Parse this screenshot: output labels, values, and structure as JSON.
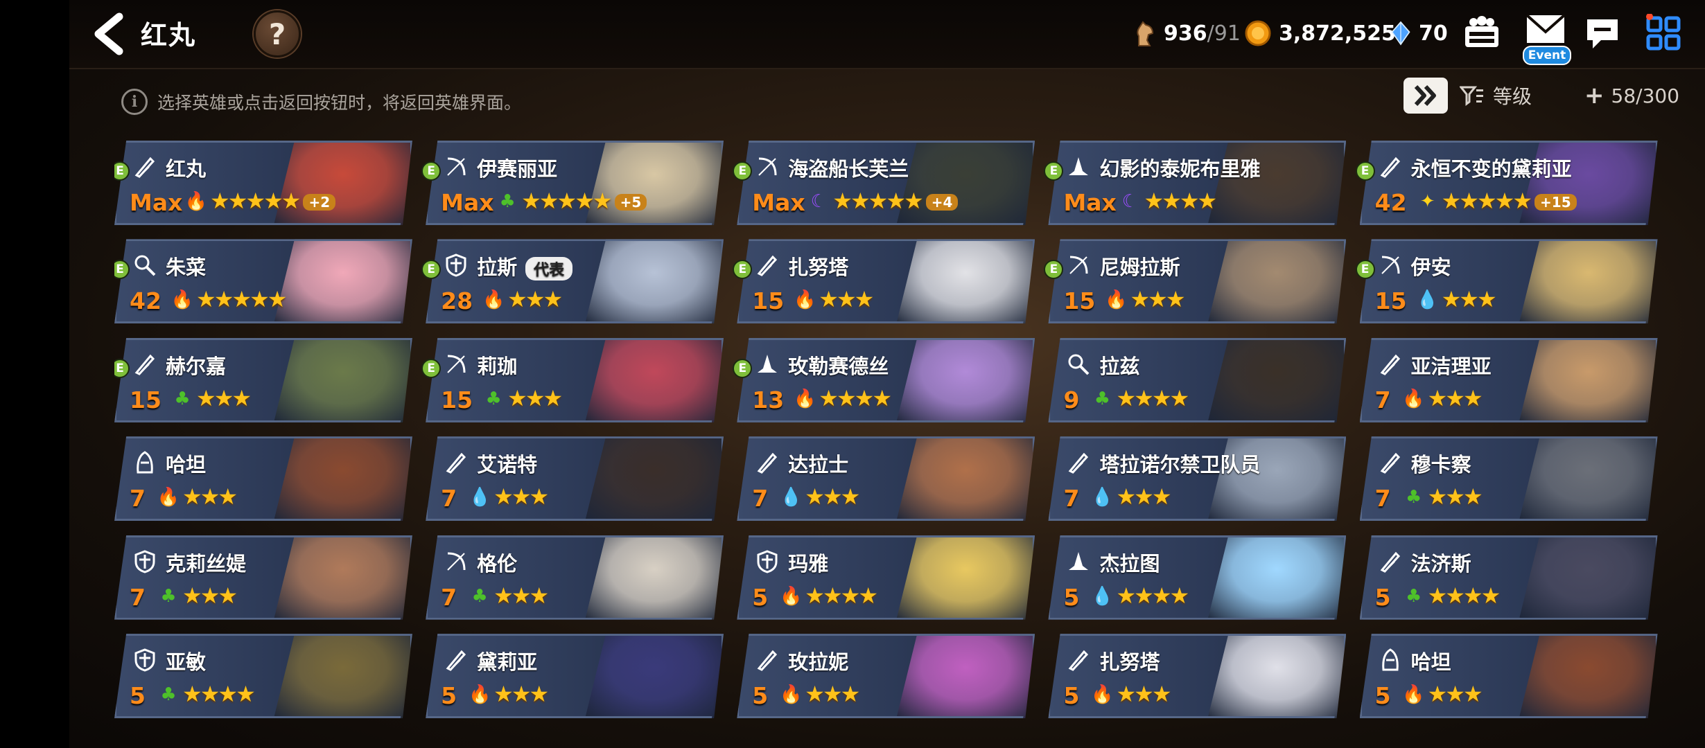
{
  "header": {
    "title": "红丸",
    "help_label": "?",
    "stamina_current": "936",
    "stamina_max": "/91",
    "gold": "3,872,525",
    "crystal": "70",
    "event_label": "Event"
  },
  "notice": {
    "icon_label": "i",
    "text": "选择英雄或点击返回按钮时，将返回英雄界面。"
  },
  "toolbar": {
    "sort_label": "等级",
    "count": "58/300"
  },
  "colors": {
    "level": "#ff8c1a",
    "star": "#ffc21a",
    "badge_e": "#7fbf3a"
  },
  "heroes": [
    {
      "name": "红丸",
      "e": true,
      "cls": "sword",
      "level": "Max",
      "elem": "fire",
      "stars": "★★★★★",
      "plus": "+2",
      "rep": ""
    },
    {
      "name": "伊赛丽亚",
      "e": true,
      "cls": "bow",
      "level": "Max",
      "elem": "tree",
      "stars": "★★★★★",
      "plus": "+5",
      "rep": ""
    },
    {
      "name": "海盗船长芙兰",
      "e": true,
      "cls": "bow",
      "level": "Max",
      "elem": "dark",
      "stars": "★★★★★",
      "plus": "+4",
      "rep": ""
    },
    {
      "name": "幻影的泰妮布里雅",
      "e": true,
      "cls": "mage",
      "level": "Max",
      "elem": "dark",
      "stars": "★★★★",
      "plus": "",
      "rep": ""
    },
    {
      "name": "永恒不变的黛莉亚",
      "e": true,
      "cls": "sword",
      "level": "42",
      "elem": "light",
      "stars": "★★★★★",
      "plus": "+15",
      "rep": ""
    },
    {
      "name": "朱菜",
      "e": true,
      "cls": "support",
      "level": "42",
      "elem": "fire",
      "stars": "★★★★★",
      "plus": "",
      "rep": ""
    },
    {
      "name": "拉斯",
      "e": true,
      "cls": "shield",
      "level": "28",
      "elem": "fire",
      "stars": "★★★",
      "plus": "",
      "rep": "代表"
    },
    {
      "name": "扎努塔",
      "e": true,
      "cls": "sword",
      "level": "15",
      "elem": "fire",
      "stars": "★★★",
      "plus": "",
      "rep": ""
    },
    {
      "name": "尼姆拉斯",
      "e": true,
      "cls": "bow",
      "level": "15",
      "elem": "fire",
      "stars": "★★★",
      "plus": "",
      "rep": ""
    },
    {
      "name": "伊安",
      "e": true,
      "cls": "bow",
      "level": "15",
      "elem": "water",
      "stars": "★★★",
      "plus": "",
      "rep": ""
    },
    {
      "name": "赫尔嘉",
      "e": true,
      "cls": "sword",
      "level": "15",
      "elem": "tree",
      "stars": "★★★",
      "plus": "",
      "rep": ""
    },
    {
      "name": "莉珈",
      "e": true,
      "cls": "bow",
      "level": "15",
      "elem": "tree",
      "stars": "★★★",
      "plus": "",
      "rep": ""
    },
    {
      "name": "玫勒赛德丝",
      "e": true,
      "cls": "mage",
      "level": "13",
      "elem": "fire",
      "stars": "★★★★",
      "plus": "",
      "rep": ""
    },
    {
      "name": "拉兹",
      "e": false,
      "cls": "support",
      "level": "9",
      "elem": "tree",
      "stars": "★★★★",
      "plus": "",
      "rep": ""
    },
    {
      "name": "亚洁理亚",
      "e": false,
      "cls": "sword",
      "level": "7",
      "elem": "fire",
      "stars": "★★★",
      "plus": "",
      "rep": ""
    },
    {
      "name": "哈坦",
      "e": false,
      "cls": "assassin",
      "level": "7",
      "elem": "fire",
      "stars": "★★★",
      "plus": "",
      "rep": ""
    },
    {
      "name": "艾诺特",
      "e": false,
      "cls": "sword",
      "level": "7",
      "elem": "water",
      "stars": "★★★",
      "plus": "",
      "rep": ""
    },
    {
      "name": "达拉士",
      "e": false,
      "cls": "sword",
      "level": "7",
      "elem": "water",
      "stars": "★★★",
      "plus": "",
      "rep": ""
    },
    {
      "name": "塔拉诺尔禁卫队员",
      "e": false,
      "cls": "sword",
      "level": "7",
      "elem": "water",
      "stars": "★★★",
      "plus": "",
      "rep": ""
    },
    {
      "name": "穆卡察",
      "e": false,
      "cls": "sword",
      "level": "7",
      "elem": "tree",
      "stars": "★★★",
      "plus": "",
      "rep": ""
    },
    {
      "name": "克莉丝媞",
      "e": false,
      "cls": "shield",
      "level": "7",
      "elem": "tree",
      "stars": "★★★",
      "plus": "",
      "rep": ""
    },
    {
      "name": "格伦",
      "e": false,
      "cls": "bow",
      "level": "7",
      "elem": "tree",
      "stars": "★★★",
      "plus": "",
      "rep": ""
    },
    {
      "name": "玛雅",
      "e": false,
      "cls": "shield",
      "level": "5",
      "elem": "fire",
      "stars": "★★★★",
      "plus": "",
      "rep": ""
    },
    {
      "name": "杰拉图",
      "e": false,
      "cls": "mage",
      "level": "5",
      "elem": "water",
      "stars": "★★★★",
      "plus": "",
      "rep": ""
    },
    {
      "name": "法济斯",
      "e": false,
      "cls": "sword",
      "level": "5",
      "elem": "tree",
      "stars": "★★★★",
      "plus": "",
      "rep": ""
    },
    {
      "name": "亚敏",
      "e": false,
      "cls": "shield",
      "level": "5",
      "elem": "tree",
      "stars": "★★★★",
      "plus": "",
      "rep": ""
    },
    {
      "name": "黛莉亚",
      "e": false,
      "cls": "sword",
      "level": "5",
      "elem": "fire",
      "stars": "★★★",
      "plus": "",
      "rep": ""
    },
    {
      "name": "玫拉妮",
      "e": false,
      "cls": "sword",
      "level": "5",
      "elem": "fire",
      "stars": "★★★",
      "plus": "",
      "rep": ""
    },
    {
      "name": "扎努塔",
      "e": false,
      "cls": "sword",
      "level": "5",
      "elem": "fire",
      "stars": "★★★",
      "plus": "",
      "rep": ""
    },
    {
      "name": "哈坦",
      "e": false,
      "cls": "assassin",
      "level": "5",
      "elem": "fire",
      "stars": "★★★",
      "plus": "",
      "rep": ""
    }
  ]
}
